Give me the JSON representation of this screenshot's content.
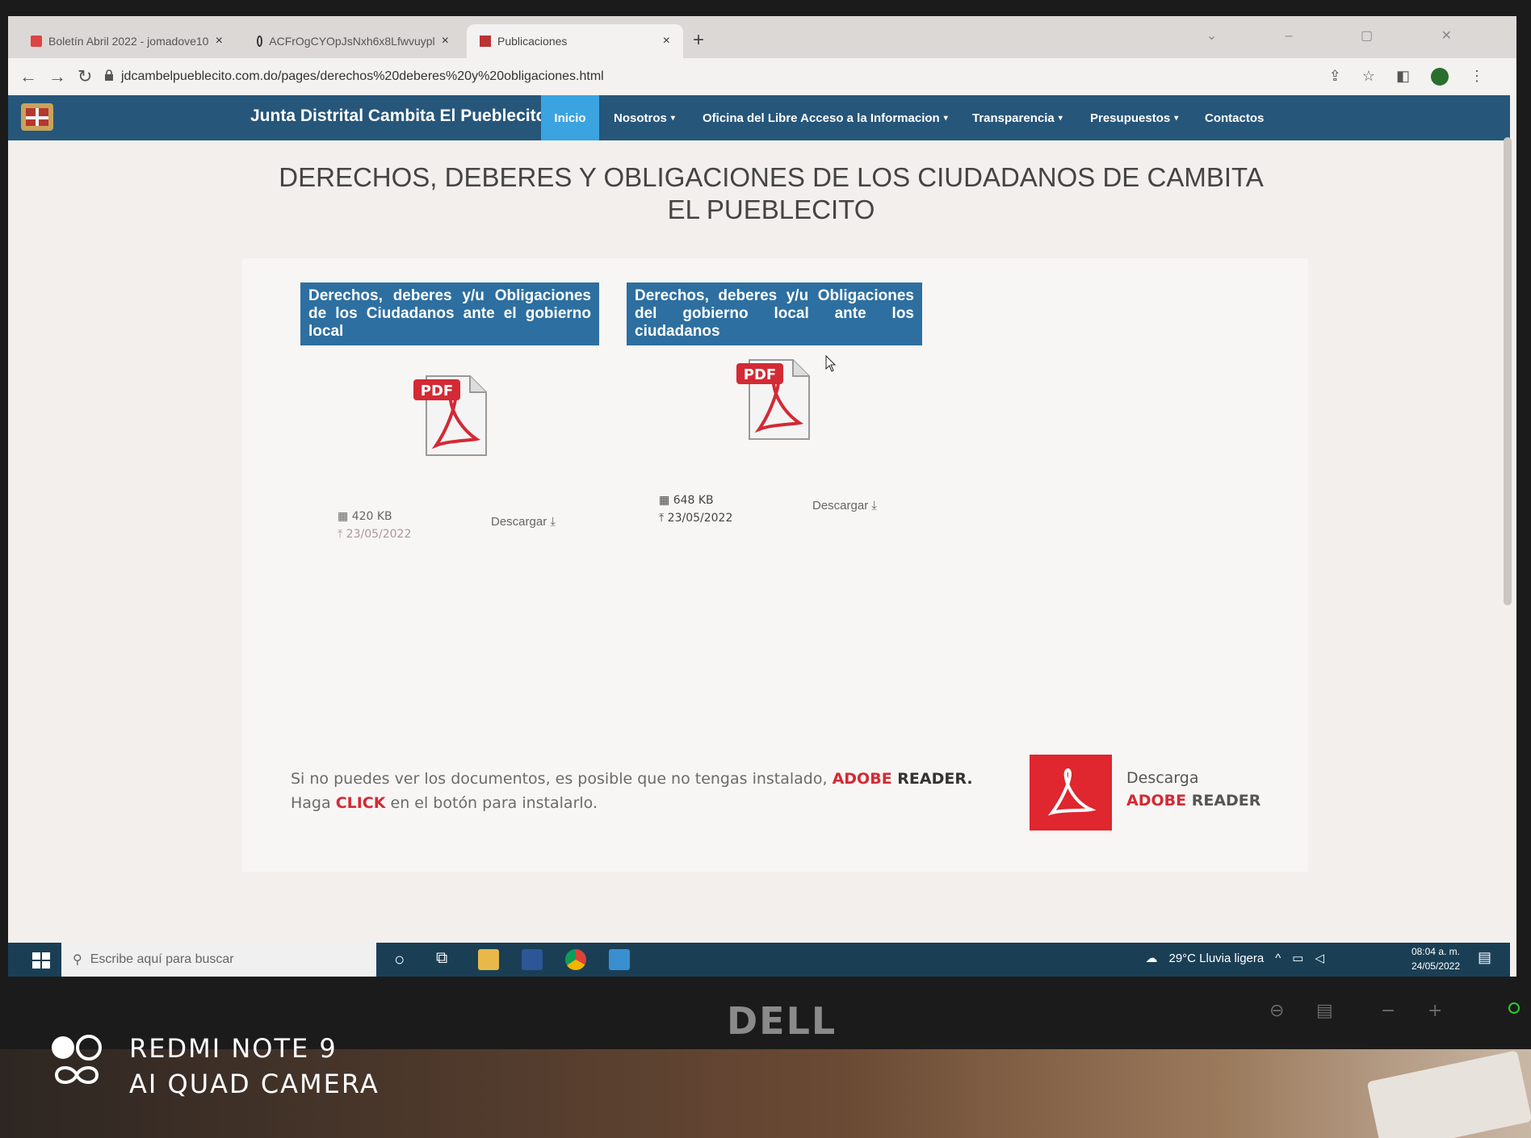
{
  "browser": {
    "tabs": [
      {
        "label": "Boletín Abril 2022 - jomadove10",
        "active": false
      },
      {
        "label": "ACFrOgCYOpJsNxh6x8Lfwvuypl",
        "active": false
      },
      {
        "label": "Publicaciones",
        "active": true
      }
    ],
    "close_glyph": "×",
    "new_tab_glyph": "+",
    "url": "jdcambelpueblecito.com.do/pages/derechos%20deberes%20y%20obligaciones.html"
  },
  "navbar": {
    "brand": "Junta Distrital Cambita El Pueblecito",
    "items": [
      {
        "label": "Inicio",
        "active": true,
        "dropdown": false
      },
      {
        "label": "Nosotros",
        "active": false,
        "dropdown": true
      },
      {
        "label": "Oficina del Libre Acceso a la Informacion",
        "active": false,
        "dropdown": true
      },
      {
        "label": "Transparencia",
        "active": false,
        "dropdown": true
      },
      {
        "label": "Presupuestos",
        "active": false,
        "dropdown": true
      },
      {
        "label": "Contactos",
        "active": false,
        "dropdown": false
      }
    ],
    "caret": "▾",
    "active_color": "#3aa3e0",
    "bar_color": "#26567a"
  },
  "page": {
    "title_line1": "DERECHOS, DEBERES Y OBLIGACIONES DE LOS CIUDADANOS DE CAMBITA",
    "title_line2": "EL PUEBLECITO"
  },
  "documents": [
    {
      "header": "Derechos, deberes y/u Obligaciones de los Ciudadanos ante el gobierno local",
      "icon": "pdf-icon",
      "pdf_label": "PDF",
      "size": "420 KB",
      "date": "23/05/2022",
      "download_label": "Descargar"
    },
    {
      "header": "Derechos, deberes y/u Obligaciones del gobierno local ante los ciudadanos",
      "icon": "pdf-icon",
      "pdf_label": "PDF",
      "size": "648 KB",
      "date": "23/05/2022",
      "download_label": "Descargar"
    }
  ],
  "adobe_note": {
    "part1": "Si no puedes ver los documentos, es posible que no tengas instalado, ",
    "adobe": "ADOBE",
    "reader": " READER.",
    "part2_a": "Haga ",
    "click": "CLICK",
    "part2_b": " en el botón para instalarlo."
  },
  "adobe_download": {
    "line1": "Descarga",
    "adobe": "ADOBE",
    "reader": " READER",
    "brand_color": "#e0262e"
  },
  "taskbar": {
    "search_placeholder": "Escribe aquí para buscar",
    "weather": "29°C  Lluvia ligera",
    "time": "08:04 a. m.",
    "date": "24/05/2022"
  },
  "photo_watermark": {
    "line1": "REDMI NOTE 9",
    "line2": "AI QUAD CAMERA"
  },
  "monitor_brand": "DELL"
}
